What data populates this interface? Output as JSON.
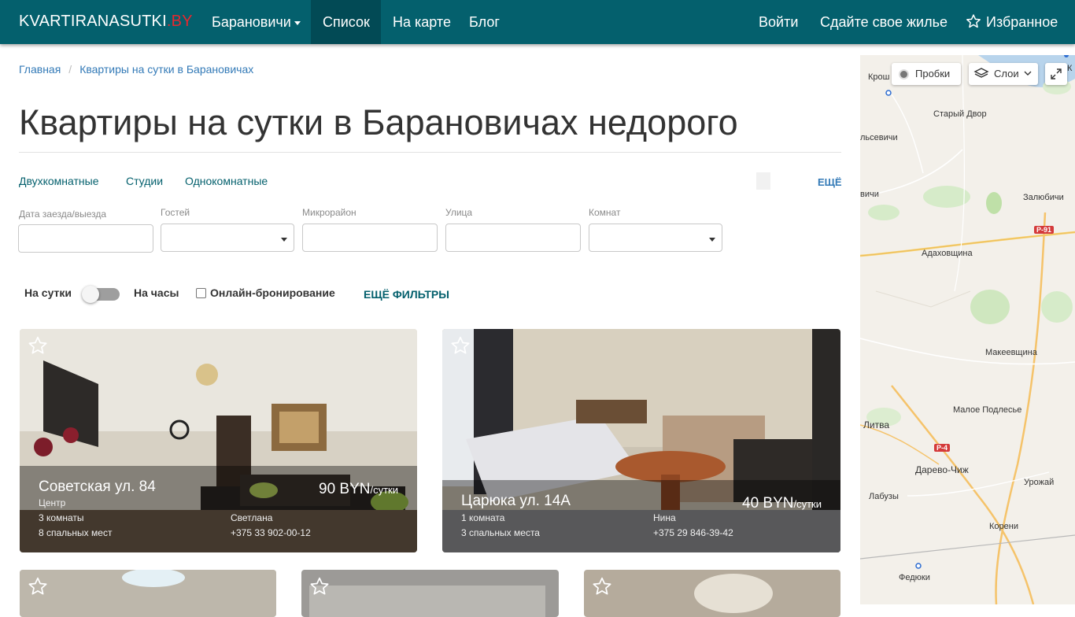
{
  "header": {
    "brand_main": "KVARTIRANASUTKI",
    "brand_tld": ".BY",
    "nav": {
      "city": "Барановичи",
      "list": "Список",
      "map": "На карте",
      "blog": "Блог"
    },
    "login": "Войти",
    "rent_out": "Сдайте свое жилье",
    "favorites": "Избранное"
  },
  "breadcrumb": {
    "home": "Главная",
    "current": "Квартиры на сутки в Барановичах"
  },
  "page_title": "Квартиры на сутки в Барановичах недорого",
  "quick_filters": [
    "Двухкомнатные",
    "Студии",
    "Однокомнатные"
  ],
  "more_label": "ЕЩЁ",
  "filters": {
    "dates_label": "Дата заезда/выезда",
    "guests_label": "Гостей",
    "district_label": "Микрорайон",
    "street_label": "Улица",
    "rooms_label": "Комнат"
  },
  "toggles": {
    "per_day": "На сутки",
    "per_hour": "На часы",
    "online_booking": "Онлайн-бронирование",
    "more_filters": "ЕЩЁ ФИЛЬТРЫ"
  },
  "listings": [
    {
      "address": "Советская ул. 84",
      "district": "Центр",
      "rooms": "3 комнаты",
      "beds": "8 спальных мест",
      "owner": "Светлана",
      "phone": "+375 33 902-00-12",
      "price": "90 BYN",
      "price_unit": "/сутки"
    },
    {
      "address": "Царюка ул. 14А",
      "rooms": "1 комната",
      "beds": "3 спальных места",
      "owner": "Нина",
      "phone": "+375 29 846-39-42",
      "price": "40 BYN",
      "price_unit": "/сутки"
    }
  ],
  "map": {
    "traffic_button": "Пробки",
    "layers_button": "Слои",
    "places": {
      "kroshin": "Крош",
      "stary_dvor": "Старый Двор",
      "selevichi": "льсевичи",
      "zalyubichi": "Залюбичи",
      "vichi": "вичи",
      "adahovshchina": "Адаховщина",
      "makeevshchina": "Макеевщина",
      "maloe_podlese": "Малое Подлесье",
      "litva": "Литва",
      "darevo_chizh": "Дарево-Чиж",
      "urozhaj": "Урожай",
      "labuzy": "Лабузы",
      "koreni": "Корени",
      "fedyuki": "Федюки",
      "edge_k": "К"
    },
    "roads": {
      "r91": "Р-91",
      "r4": "Р-4"
    }
  },
  "colors": {
    "navbar": "#04606d",
    "navbar_active": "#024a55",
    "brand_tld": "#e8272e",
    "link": "#337ab7"
  }
}
